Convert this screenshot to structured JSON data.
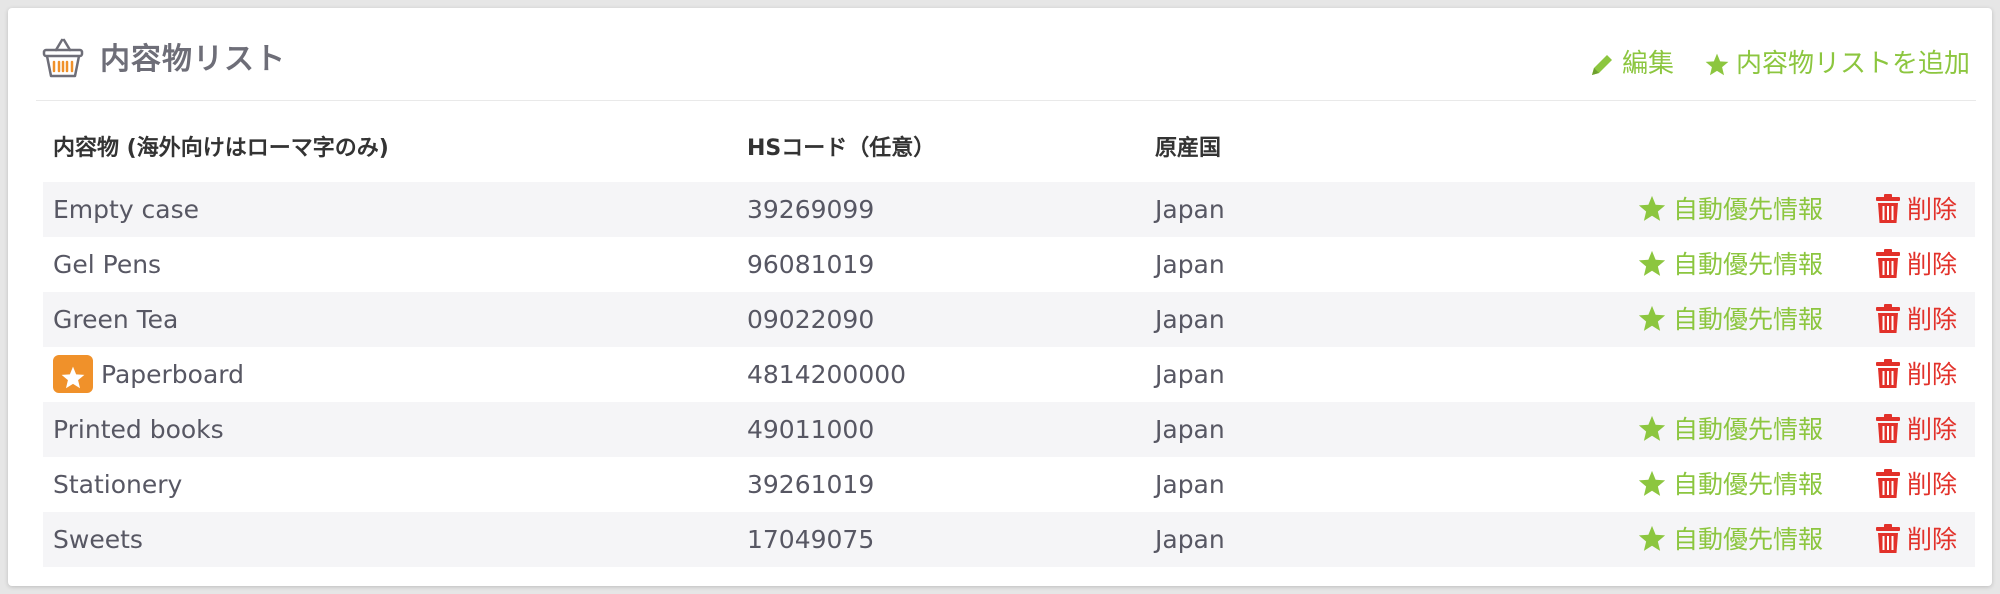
{
  "header": {
    "title": "内容物リスト",
    "edit_label": "編集",
    "add_label": "内容物リストを追加"
  },
  "table": {
    "columns": [
      "内容物 (海外向けはローマ字のみ)",
      "HSコード（任意）",
      "原産国"
    ],
    "auto_label": "自動優先情報",
    "delete_label": "削除",
    "rows": [
      {
        "name": "Empty case",
        "hs": "39269099",
        "origin": "Japan",
        "favorite": false
      },
      {
        "name": "Gel Pens",
        "hs": "96081019",
        "origin": "Japan",
        "favorite": false
      },
      {
        "name": "Green Tea",
        "hs": "09022090",
        "origin": "Japan",
        "favorite": false
      },
      {
        "name": "Paperboard",
        "hs": "4814200000",
        "origin": "Japan",
        "favorite": true
      },
      {
        "name": "Printed books",
        "hs": "49011000",
        "origin": "Japan",
        "favorite": false
      },
      {
        "name": "Stationery",
        "hs": "39261019",
        "origin": "Japan",
        "favorite": false
      },
      {
        "name": "Sweets",
        "hs": "17049075",
        "origin": "Japan",
        "favorite": false
      }
    ]
  },
  "colors": {
    "accent_green": "#8cc63f",
    "delete_red": "#e2312a",
    "favorite_orange": "#f0912a"
  },
  "icons": {
    "header": "basket-icon",
    "edit": "pencil-icon",
    "add": "star-icon",
    "auto": "star-icon",
    "delete": "trash-icon"
  }
}
